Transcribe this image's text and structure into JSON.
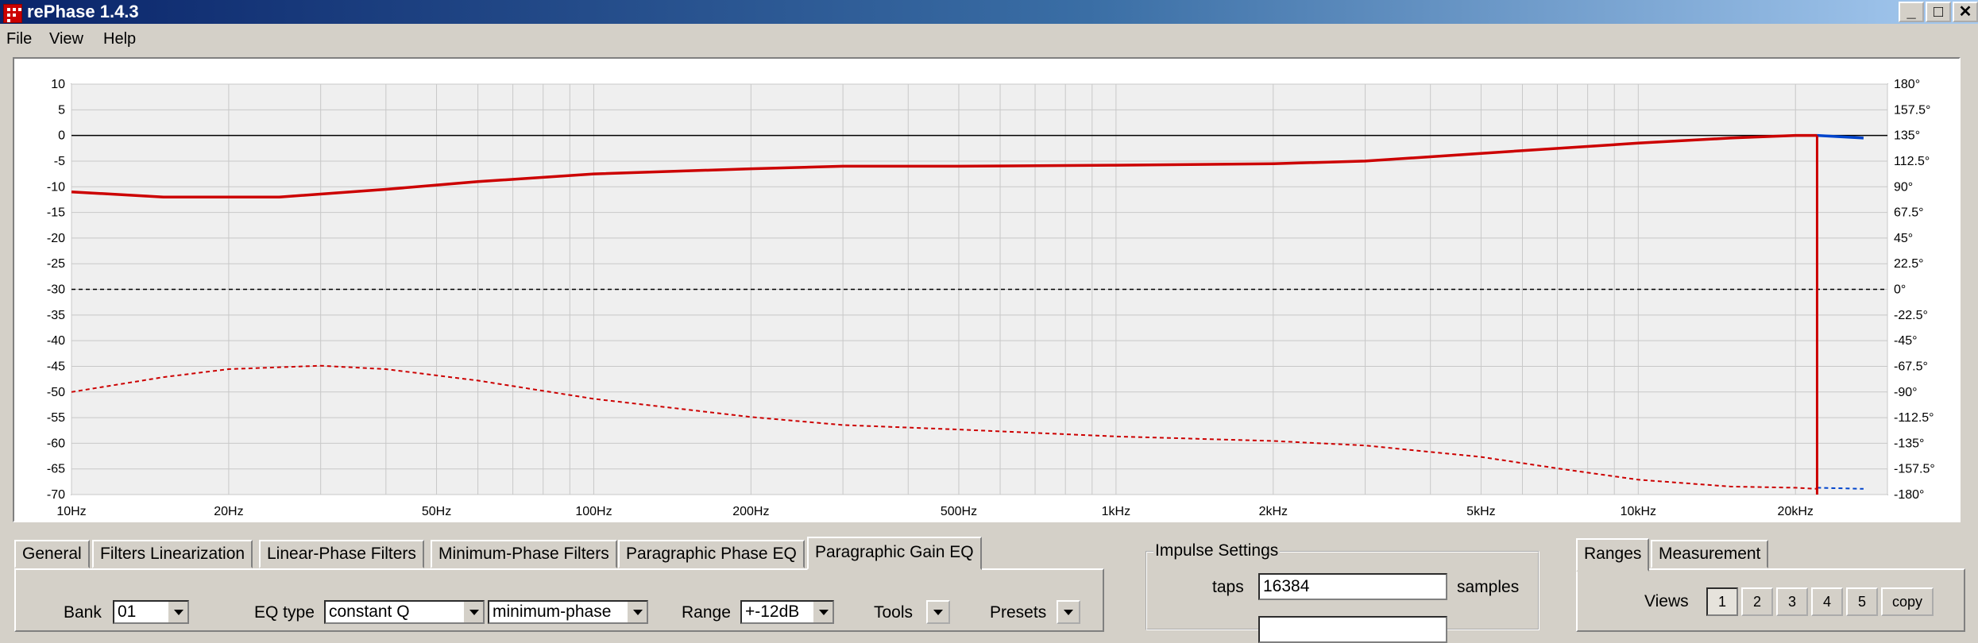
{
  "window": {
    "title": "rePhase 1.4.3"
  },
  "menu": [
    "File",
    "View",
    "Help"
  ],
  "chart_data": {
    "type": "line",
    "title": "",
    "x_scale": "log",
    "xlim": [
      10,
      30000
    ],
    "x_ticks": [
      10,
      20,
      50,
      100,
      200,
      500,
      1000,
      2000,
      5000,
      10000,
      20000
    ],
    "x_tick_labels": [
      "10Hz",
      "20Hz",
      "50Hz",
      "100Hz",
      "200Hz",
      "500Hz",
      "1kHz",
      "2kHz",
      "5kHz",
      "10kHz",
      "20kHz"
    ],
    "ylim": [
      -70,
      10
    ],
    "y_ticks": [
      10,
      5,
      0,
      -5,
      -10,
      -15,
      -20,
      -25,
      -30,
      -35,
      -40,
      -45,
      -50,
      -55,
      -60,
      -65,
      -70
    ],
    "y2lim": [
      -180,
      180
    ],
    "y2_tick_labels": [
      "180°",
      "157.5°",
      "135°",
      "112.5°",
      "90°",
      "67.5°",
      "45°",
      "22.5°",
      "0°",
      "-22.5°",
      "-45°",
      "-67.5°",
      "-90°",
      "-112.5°",
      "-135°",
      "-157.5°",
      "-180°"
    ],
    "grid": true,
    "colors": {
      "magnitude": "#cc0000",
      "phase": "#cc0000",
      "blue": "#0044cc"
    },
    "series": [
      {
        "axis": "left",
        "style": "solid",
        "x": [
          10,
          15,
          25,
          40,
          60,
          100,
          200,
          300,
          500,
          1000,
          2000,
          3000,
          5000,
          10000,
          15000,
          20000,
          22000
        ],
        "y": [
          -11,
          -12,
          -12,
          -10.5,
          -9,
          -7.5,
          -6.5,
          -6,
          -6,
          -5.8,
          -5.5,
          -5,
          -3.5,
          -1.5,
          -0.5,
          0,
          0
        ]
      },
      {
        "axis": "right",
        "style": "dashed",
        "x": [
          10,
          15,
          20,
          30,
          40,
          60,
          100,
          200,
          300,
          500,
          1000,
          2000,
          3000,
          5000,
          7000,
          10000,
          15000,
          20000,
          22000
        ],
        "y": [
          -90,
          -77,
          -70,
          -67,
          -70,
          -80,
          -96,
          -112,
          -119,
          -123,
          -129,
          -133,
          -137,
          -147,
          -157,
          -167,
          -173,
          -174,
          -175
        ]
      },
      {
        "axis": "left",
        "style": "solid",
        "x": [
          22000,
          27000
        ],
        "y": [
          0,
          -0.5
        ]
      },
      {
        "axis": "right",
        "style": "dashed",
        "x": [
          22000,
          27000
        ],
        "y": [
          -174,
          -175
        ]
      }
    ]
  },
  "tabs": [
    "General",
    "Filters Linearization",
    "Linear-Phase Filters",
    "Minimum-Phase Filters",
    "Paragraphic Phase EQ",
    "Paragraphic Gain EQ"
  ],
  "eq_panel": {
    "bank_label": "Bank",
    "bank_value": "01",
    "eq_type_label": "EQ type",
    "eq_type_value": "constant Q",
    "phase_type_value": "minimum-phase",
    "range_label": "Range",
    "range_value": "+-12dB",
    "tools_label": "Tools",
    "presets_label": "Presets"
  },
  "impulse": {
    "group_title": "Impulse Settings",
    "taps_label": "taps",
    "taps_value": "16384",
    "samples_label": "samples"
  },
  "right_tabs": [
    "Ranges",
    "Measurement"
  ],
  "views": {
    "label": "Views",
    "buttons": [
      "1",
      "2",
      "3",
      "4",
      "5"
    ],
    "copy_label": "copy"
  }
}
